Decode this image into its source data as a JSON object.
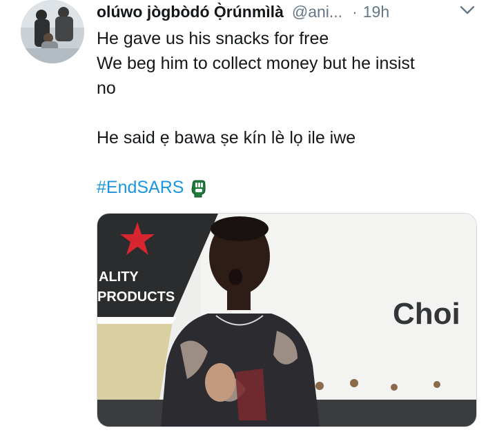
{
  "tweet": {
    "author_name": "olúwo jògbòdó Ọ̀rúnmìlà",
    "author_handle": "@ani...",
    "separator": "·",
    "time": "19h",
    "lines": [
      "He gave us his snacks  for free",
      "We beg him to collect money but he insist",
      "no",
      "",
      "He said ẹ bawa ṣe kín lè lọ ile iwe"
    ],
    "hashtag": "#EndSARS",
    "hashtag_emoji": "green-fist-endsars-emoji"
  },
  "media": {
    "sign_text_1": "ALITY",
    "sign_text_2": "PRODUCTS",
    "sign_text_3": "Choi",
    "colors": {
      "star": "#d7262f",
      "dark_panel": "#2a2c2e",
      "truck_white": "#f3f3f1"
    }
  },
  "icons": {
    "menu": "chevron-down-icon"
  },
  "colors": {
    "link": "#1b95e0",
    "secondary_text": "#657786"
  }
}
